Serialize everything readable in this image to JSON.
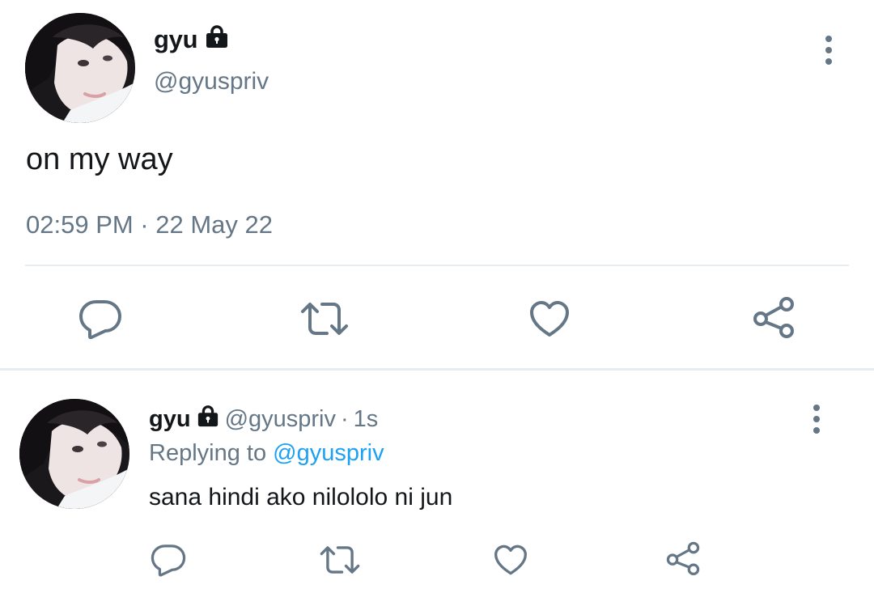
{
  "main_tweet": {
    "display_name": "gyu",
    "handle": "@gyuspriv",
    "text": "on my way",
    "timestamp": "02:59 PM · 22 May 22",
    "protected": true,
    "avatar_icon": "profile-photo",
    "more_icon": "more-vertical-icon",
    "actions": [
      "reply-icon",
      "retweet-icon",
      "like-icon",
      "share-icon"
    ]
  },
  "reply_tweet": {
    "display_name": "gyu",
    "handle": "@gyuspriv",
    "separator": "·",
    "age": "1s",
    "replying_prefix": "Replying to",
    "replying_to": "@gyuspriv",
    "text": "sana hindi ako nilololo ni jun",
    "protected": true,
    "avatar_icon": "profile-photo",
    "more_icon": "more-vertical-icon",
    "actions": [
      "reply-icon",
      "retweet-icon",
      "like-icon",
      "share-icon"
    ]
  },
  "colors": {
    "text_primary": "#14171a",
    "text_secondary": "#657786",
    "link": "#1da1f2",
    "divider": "#e6ecf0",
    "icon": "#657786"
  }
}
